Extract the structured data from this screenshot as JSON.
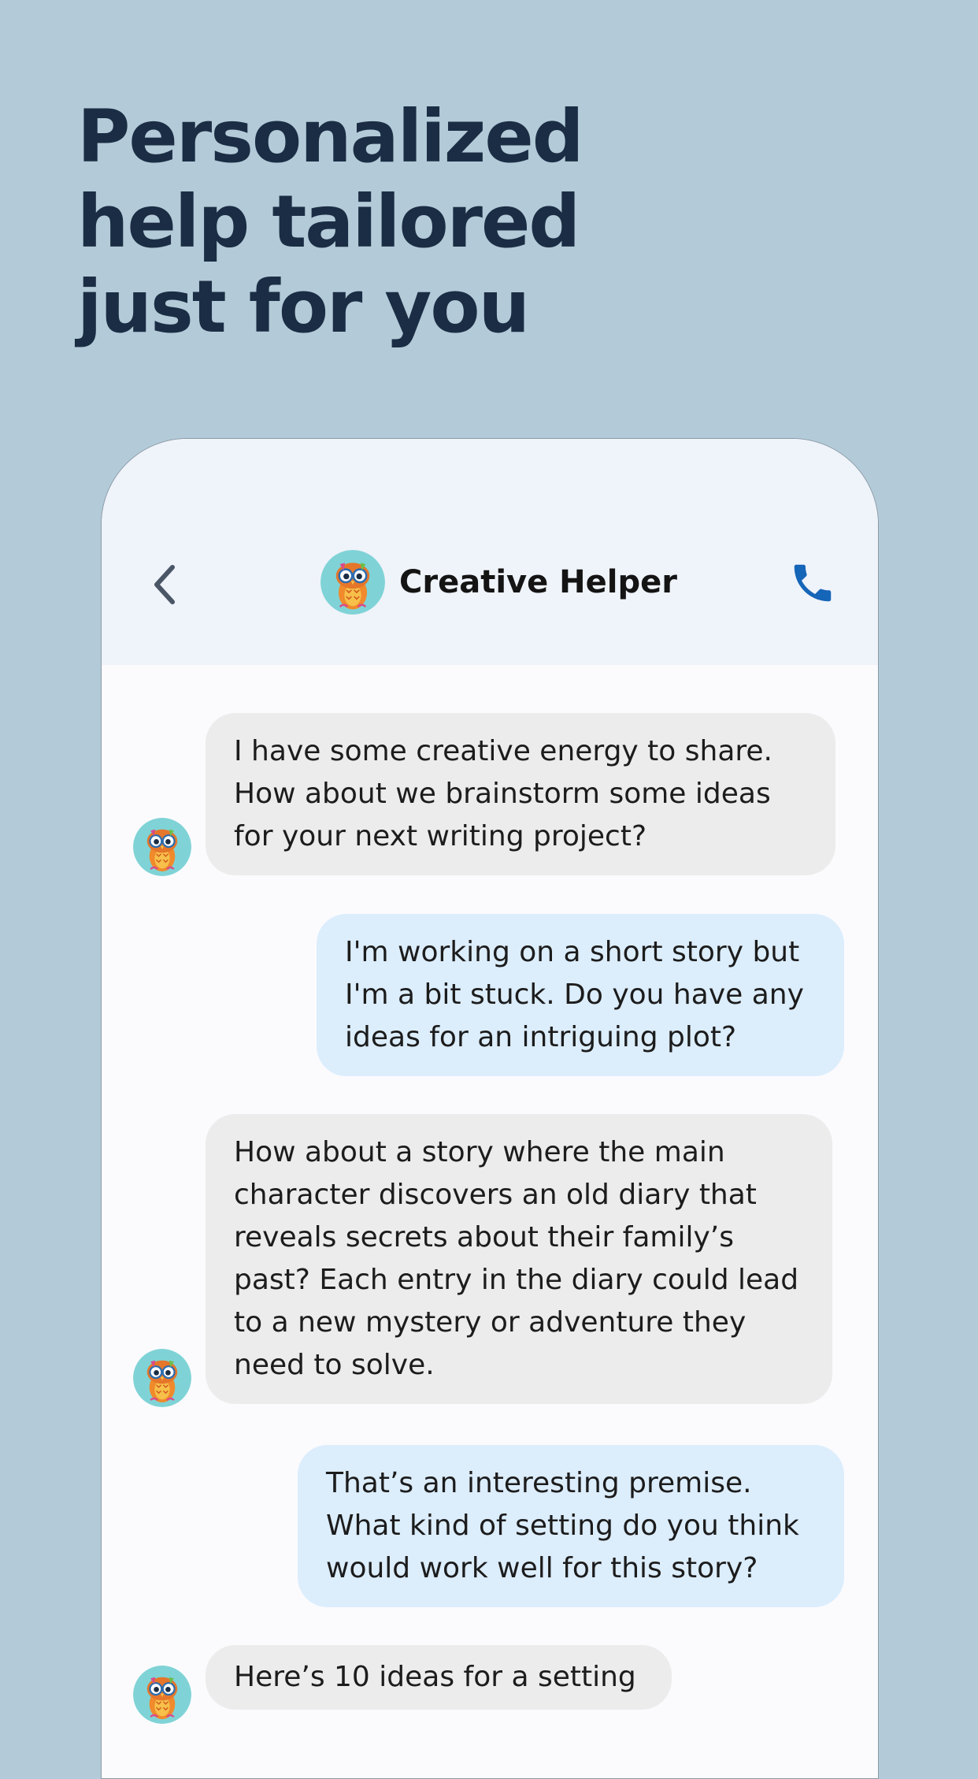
{
  "headline": {
    "lines": [
      "Personalized",
      "help tailored",
      "just for you"
    ]
  },
  "header": {
    "title": "Creative Helper",
    "back_icon": "chevron-left-icon",
    "call_icon": "phone-icon",
    "avatar_icon": "owl-avatar-icon"
  },
  "colors": {
    "background": "#b3cbd8",
    "headline": "#1b2d44",
    "header_bg": "#eff3fa",
    "bot_bubble": "#ececec",
    "user_bubble": "#dcedfc",
    "call_icon": "#1565b8"
  },
  "messages": [
    {
      "sender": "bot",
      "text": "I have some creative energy to share. How about we brainstorm some ideas for your next writing project?"
    },
    {
      "sender": "user",
      "text": "I'm working on a short story but I'm a bit stuck. Do you have any ideas for an intriguing plot?"
    },
    {
      "sender": "bot",
      "text": "How about a story where the main character discovers an old diary that reveals secrets about their family’s past? Each entry in the diary could lead to a new mystery or adventure they need to solve."
    },
    {
      "sender": "user",
      "text": "That’s an interesting premise. What kind of setting do you think would work well for this story?"
    },
    {
      "sender": "bot",
      "text": "Here’s 10 ideas for a setting"
    }
  ]
}
